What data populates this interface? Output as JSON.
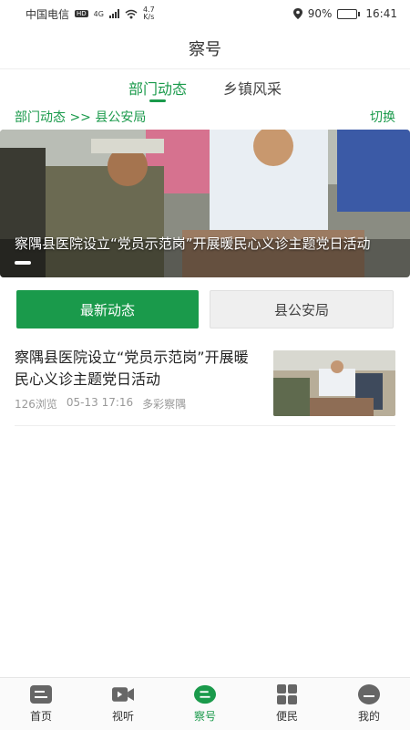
{
  "status_bar": {
    "carrier": "中国电信",
    "network_badge": "HD",
    "network_type": "4G",
    "speed_value": "4.7",
    "speed_unit": "K/s",
    "battery_percent": "90%",
    "time": "16:41",
    "battery_level": 0.9
  },
  "header": {
    "title": "察号"
  },
  "tabs": [
    {
      "label": "部门动态",
      "active": true
    },
    {
      "label": "乡镇风采",
      "active": false
    }
  ],
  "breadcrumb": {
    "path": "部门动态 >> 县公安局",
    "switch_label": "切换"
  },
  "banner": {
    "caption": "察隅县医院设立“党员示范岗”开展暖民心义诊主题党日活动"
  },
  "switch_buttons": {
    "latest": "最新动态",
    "department": "县公安局"
  },
  "news": [
    {
      "title": "察隅县医院设立“党员示范岗”开展暖民心义诊主题党日活动",
      "views": "126浏览",
      "date": "05-13 17:16",
      "source": "多彩察隅"
    }
  ],
  "bottom_nav": [
    {
      "label": "首页",
      "icon": "home-icon",
      "active": false
    },
    {
      "label": "视听",
      "icon": "video-icon",
      "active": false
    },
    {
      "label": "察号",
      "icon": "chahao-icon",
      "active": true
    },
    {
      "label": "便民",
      "icon": "grid-icon",
      "active": false
    },
    {
      "label": "我的",
      "icon": "profile-icon",
      "active": false
    }
  ],
  "colors": {
    "accent": "#1a9a4b",
    "secondary_button_bg": "#efefef"
  }
}
